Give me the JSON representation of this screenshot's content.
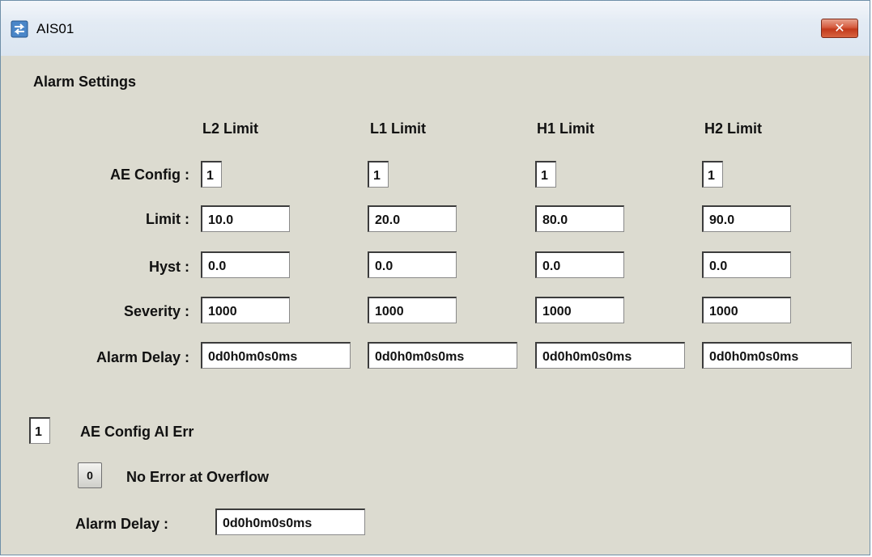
{
  "window": {
    "title": "AIS01"
  },
  "section": {
    "title": "Alarm Settings"
  },
  "columns": [
    "L2 Limit",
    "L1 Limit",
    "H1 Limit",
    "H2 Limit"
  ],
  "rows": {
    "ae_config": {
      "label": "AE Config :",
      "values": [
        "1",
        "1",
        "1",
        "1"
      ]
    },
    "limit": {
      "label": "Limit :",
      "values": [
        "10.0",
        "20.0",
        "80.0",
        "90.0"
      ]
    },
    "hyst": {
      "label": "Hyst :",
      "values": [
        "0.0",
        "0.0",
        "0.0",
        "0.0"
      ]
    },
    "severity": {
      "label": "Severity :",
      "values": [
        "1000",
        "1000",
        "1000",
        "1000"
      ]
    },
    "alarm_delay": {
      "label": "Alarm Delay :",
      "values": [
        "0d0h0m0s0ms",
        "0d0h0m0s0ms",
        "0d0h0m0s0ms",
        "0d0h0m0s0ms"
      ]
    }
  },
  "ai_err": {
    "config_value": "1",
    "config_label": "AE Config AI Err",
    "overflow_button": "0",
    "overflow_label": "No Error at Overflow",
    "delay_label": "Alarm Delay :",
    "delay_value": "0d0h0m0s0ms"
  },
  "icons": {
    "window": "link-arrows-icon",
    "close": "close-icon"
  }
}
